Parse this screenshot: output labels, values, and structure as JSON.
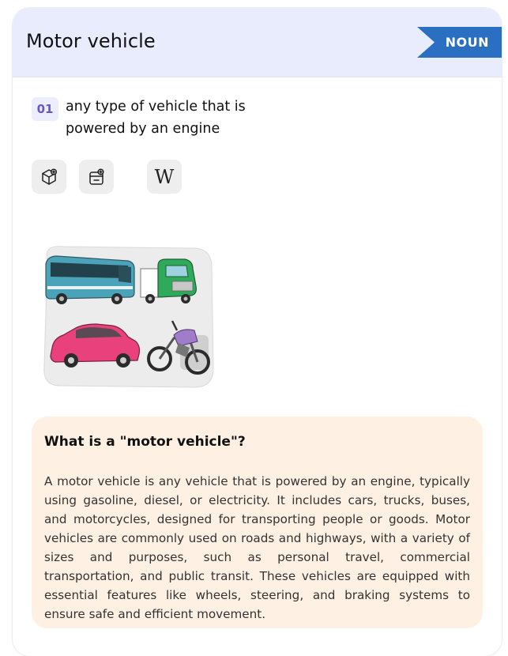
{
  "entry": {
    "word": "Motor vehicle",
    "part_of_speech": "NOUN"
  },
  "definition": {
    "number": "01",
    "text": "any type of vehicle that is powered by an engine"
  },
  "tools": [
    {
      "icon": "cube-icon"
    },
    {
      "icon": "flashcard-add-icon"
    },
    {
      "icon": "wikipedia-icon",
      "glyph": "W"
    }
  ],
  "illustration": {
    "icon": "vehicles-illustration"
  },
  "info": {
    "title": "What is a \"motor vehicle\"?",
    "body": "A motor vehicle is any vehicle that is powered by an engine, typically using gasoline, diesel, or electricity. It includes cars, trucks, buses, and motorcycles, designed for transporting people or goods. Motor vehicles are commonly used on roads and highways, with a variety of sizes and purposes, such as personal travel, commercial transportation, and public transit. These vehicles are equipped with essential features like wheels, steering, and braking systems to ensure safe and efficient movement."
  },
  "colors": {
    "header_bg": "#e9ecfd",
    "badge_bg": "#2b6fc2",
    "number_text": "#6a55c9",
    "info_bg": "#fef0e2"
  }
}
